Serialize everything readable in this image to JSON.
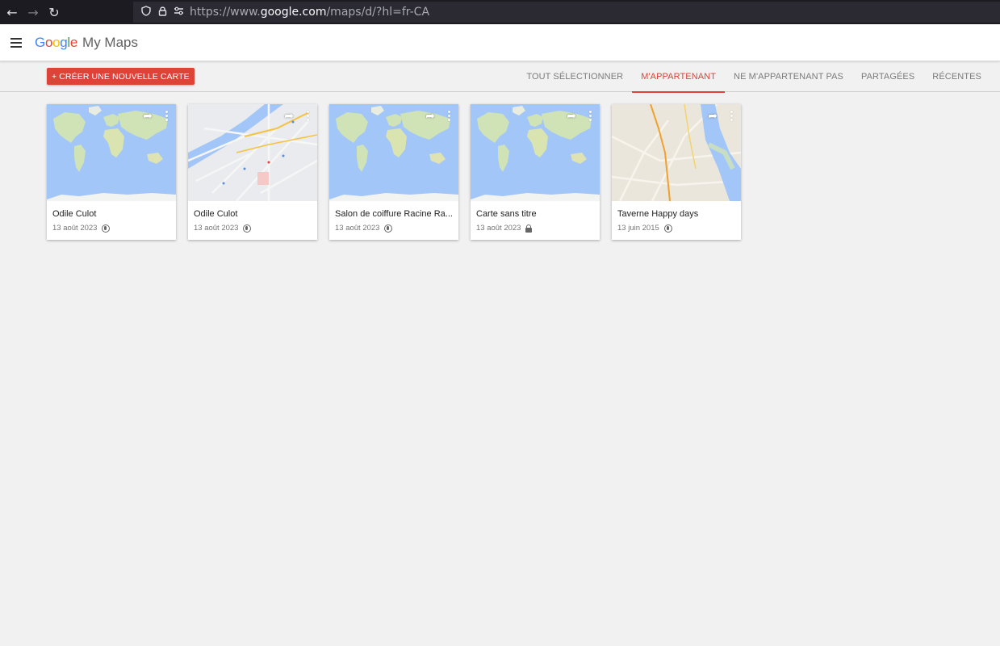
{
  "browser": {
    "back_icon": "←",
    "forward_icon": "→",
    "reload_icon": "↻",
    "shield_icon": "⛉",
    "lock_icon": "🔒",
    "permissions_icon": "⇄",
    "url_prefix": "https://www.",
    "url_domain": "google.com",
    "url_path": "/maps/d/?hl=fr-CA"
  },
  "header": {
    "logo_letters": [
      "G",
      "o",
      "o",
      "g",
      "l",
      "e"
    ],
    "product": "My Maps"
  },
  "toolbar": {
    "create_label": "+ CRÉER UNE NOUVELLE CARTE",
    "tabs": [
      {
        "label": "TOUT SÉLECTIONNER",
        "active": false
      },
      {
        "label": "M'APPARTENANT",
        "active": true
      },
      {
        "label": "NE M'APPARTENANT PAS",
        "active": false
      },
      {
        "label": "PARTAGÉES",
        "active": false
      },
      {
        "label": "RÉCENTES",
        "active": false
      }
    ]
  },
  "colors": {
    "accent": "#db4437",
    "ocean": "#a3c6f8",
    "land": "#cfe3b6"
  },
  "cards": [
    {
      "title": "Odile Culot",
      "date": "13 août 2023",
      "visibility": "public",
      "thumb": "world",
      "share_icon": "➦",
      "visibility_icon": "globe-icon"
    },
    {
      "title": "Odile Culot",
      "date": "13 août 2023",
      "visibility": "public",
      "thumb": "city",
      "share_icon": "➦",
      "visibility_icon": "globe-icon"
    },
    {
      "title": "Salon de coiffure Racine Ra...",
      "date": "13 août 2023",
      "visibility": "public",
      "thumb": "world",
      "share_icon": "➦",
      "visibility_icon": "globe-icon"
    },
    {
      "title": "Carte sans titre",
      "date": "13 août 2023",
      "visibility": "private",
      "thumb": "world",
      "share_icon": "➦",
      "visibility_icon": "lock-icon"
    },
    {
      "title": "Taverne Happy days",
      "date": "13 juin 2015",
      "visibility": "public",
      "thumb": "street",
      "share_icon": "➦",
      "visibility_icon": "globe-icon"
    }
  ]
}
